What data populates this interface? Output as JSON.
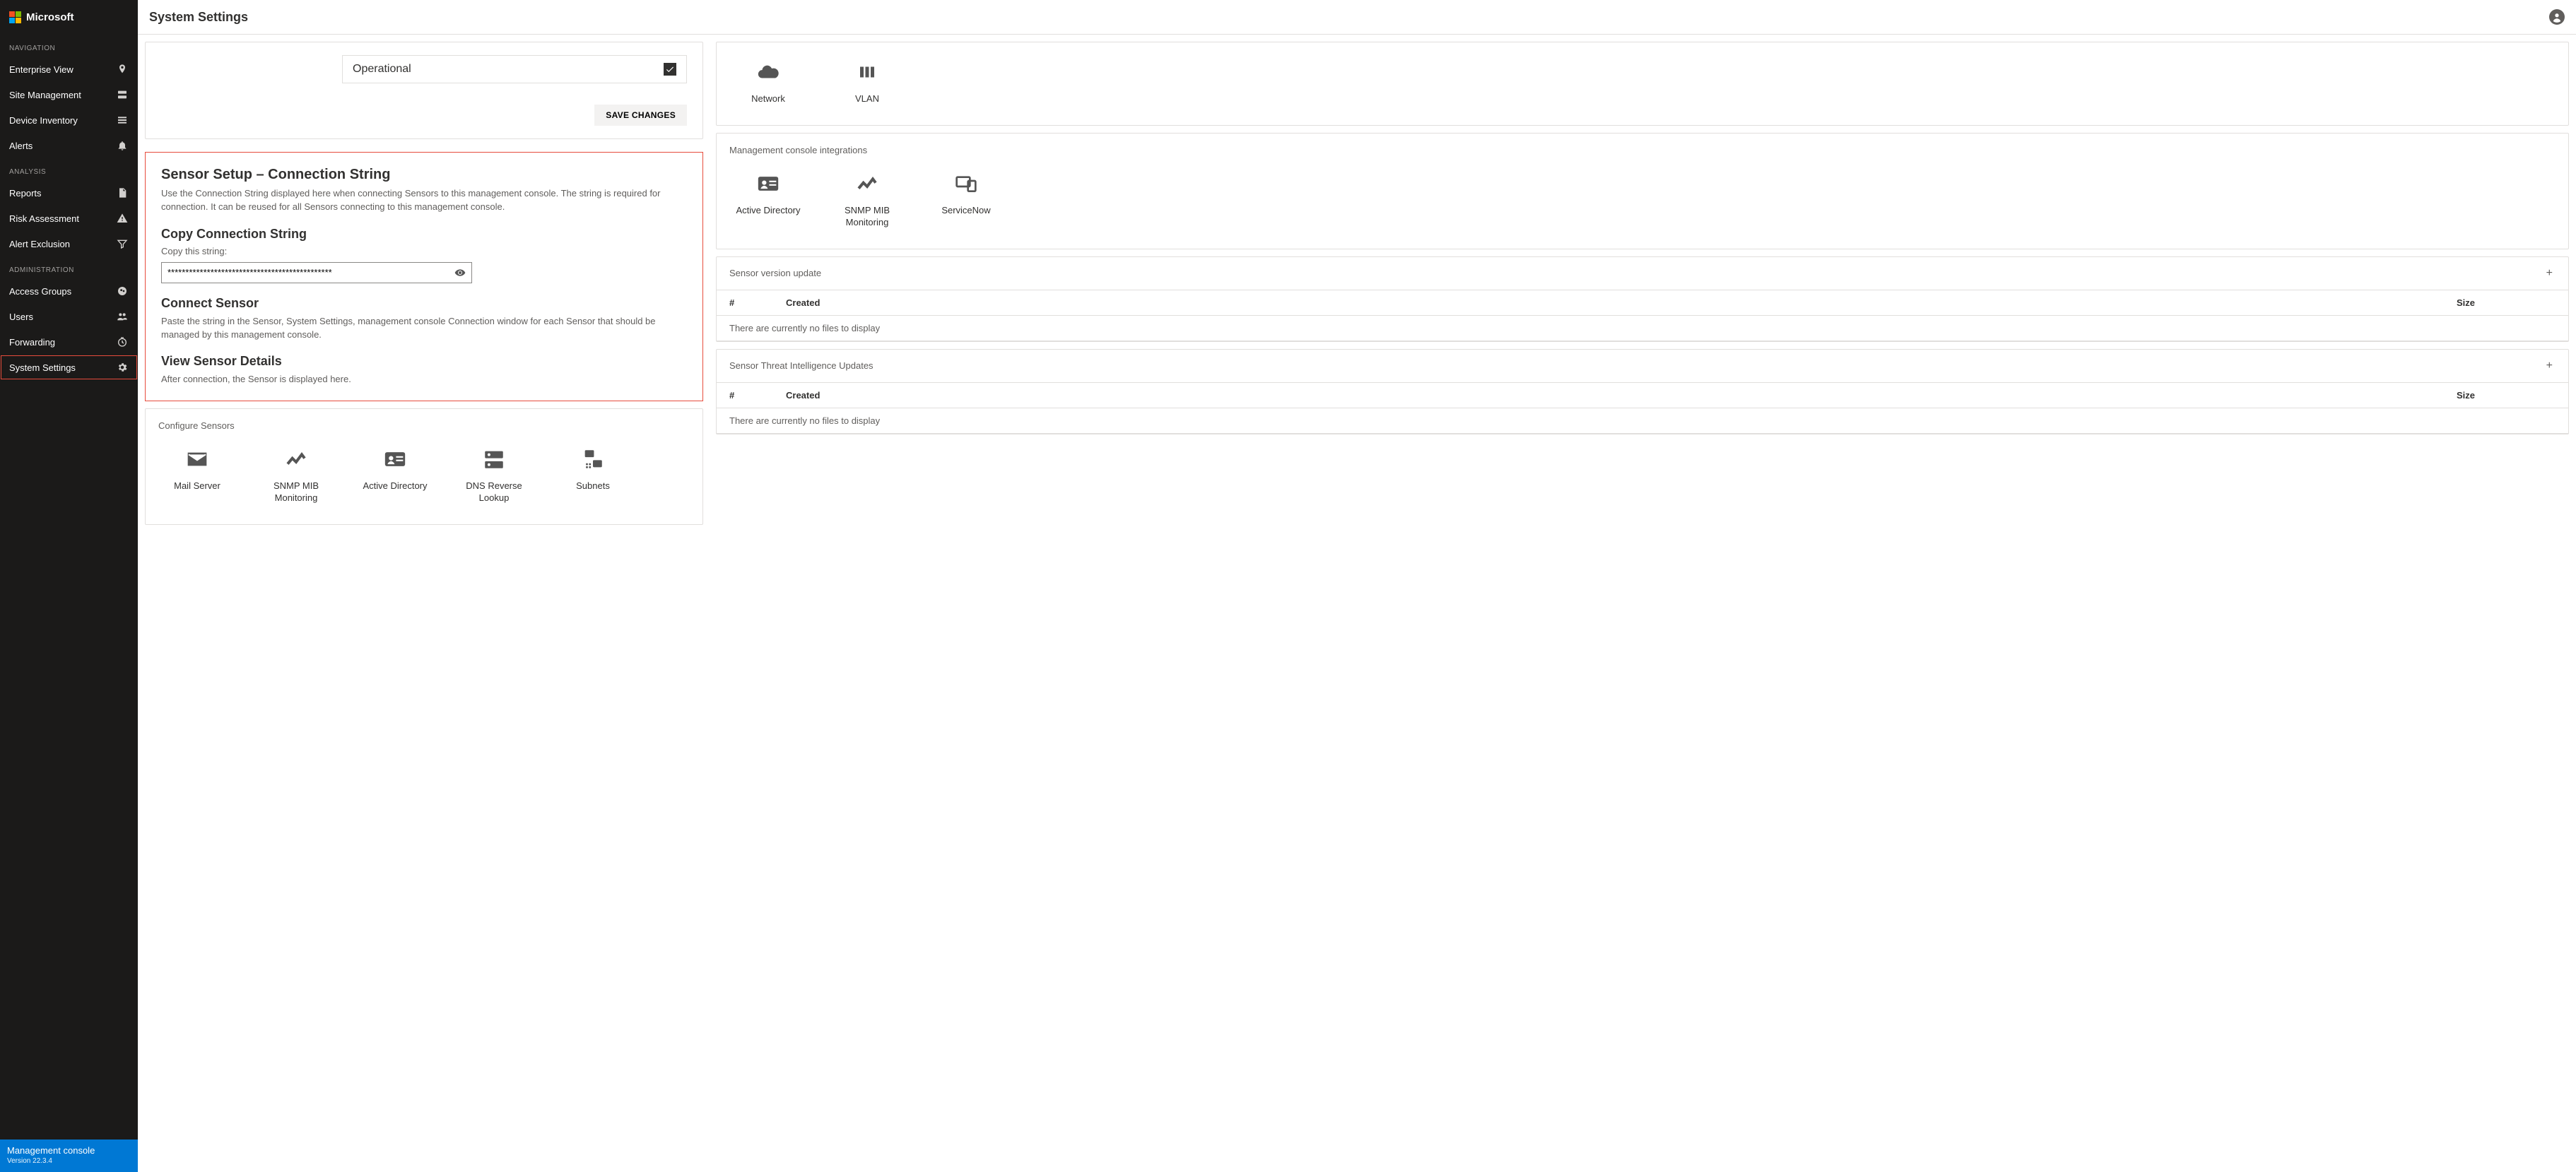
{
  "brand": "Microsoft",
  "page_title": "System Settings",
  "sidebar": {
    "sections": [
      {
        "title": "NAVIGATION",
        "items": [
          {
            "label": "Enterprise View",
            "name": "enterprise-view",
            "icon": "map-pin"
          },
          {
            "label": "Site Management",
            "name": "site-management",
            "icon": "server"
          },
          {
            "label": "Device Inventory",
            "name": "device-inventory",
            "icon": "list"
          },
          {
            "label": "Alerts",
            "name": "alerts",
            "icon": "bell"
          }
        ]
      },
      {
        "title": "ANALYSIS",
        "items": [
          {
            "label": "Reports",
            "name": "reports",
            "icon": "file"
          },
          {
            "label": "Risk Assessment",
            "name": "risk-assessment",
            "icon": "warning"
          },
          {
            "label": "Alert Exclusion",
            "name": "alert-exclusion",
            "icon": "filter"
          }
        ]
      },
      {
        "title": "ADMINISTRATION",
        "items": [
          {
            "label": "Access Groups",
            "name": "access-groups",
            "icon": "group-circle"
          },
          {
            "label": "Users",
            "name": "users",
            "icon": "people"
          },
          {
            "label": "Forwarding",
            "name": "forwarding",
            "icon": "clock"
          },
          {
            "label": "System Settings",
            "name": "system-settings",
            "icon": "gear",
            "active": true
          }
        ]
      }
    ]
  },
  "footer": {
    "title": "Management console",
    "subtitle": "Version 22.3.4"
  },
  "left": {
    "operational": {
      "label": "Operational",
      "checked": true,
      "save_button": "SAVE CHANGES"
    },
    "sensor_setup": {
      "title": "Sensor Setup – Connection String",
      "desc": "Use the Connection String displayed here when connecting Sensors to this management console. The string is required for connection. It can be reused for all Sensors connecting to this management console.",
      "copy_title": "Copy Connection String",
      "copy_label": "Copy this string:",
      "conn_value": "**********************************************",
      "connect_title": "Connect Sensor",
      "connect_desc": "Paste the string in the Sensor, System Settings, management console Connection window for each Sensor that should be managed by this management console.",
      "view_title": "View Sensor Details",
      "view_desc": "After connection, the Sensor is displayed here."
    },
    "configure_sensors": {
      "title": "Configure Sensors",
      "tiles": [
        {
          "label": "Mail Server",
          "icon": "mail",
          "name": "mail-server"
        },
        {
          "label": "SNMP MIB Monitoring",
          "icon": "snmp",
          "name": "snmp-mib-monitoring"
        },
        {
          "label": "Active Directory",
          "icon": "badge",
          "name": "active-directory"
        },
        {
          "label": "DNS Reverse Lookup",
          "icon": "dns",
          "name": "dns-reverse-lookup"
        },
        {
          "label": "Subnets",
          "icon": "subnets",
          "name": "subnets"
        }
      ]
    }
  },
  "right": {
    "top_tiles": [
      {
        "label": "Network",
        "icon": "cloud",
        "name": "network"
      },
      {
        "label": "VLAN",
        "icon": "vlan",
        "name": "vlan"
      }
    ],
    "integrations": {
      "title": "Management console integrations",
      "tiles": [
        {
          "label": "Active Directory",
          "icon": "badge",
          "name": "active-directory"
        },
        {
          "label": "SNMP MIB Monitoring",
          "icon": "snmp",
          "name": "snmp-mib-monitoring"
        },
        {
          "label": "ServiceNow",
          "icon": "devices",
          "name": "servicenow"
        }
      ]
    },
    "version_update": {
      "title": "Sensor version update",
      "columns": {
        "c1": "#",
        "c2": "Created",
        "c3": "Size"
      },
      "empty": "There are currently no files to display"
    },
    "threat_intel": {
      "title": "Sensor Threat Intelligence Updates",
      "columns": {
        "c1": "#",
        "c2": "Created",
        "c3": "Size"
      },
      "empty": "There are currently no files to display"
    }
  }
}
